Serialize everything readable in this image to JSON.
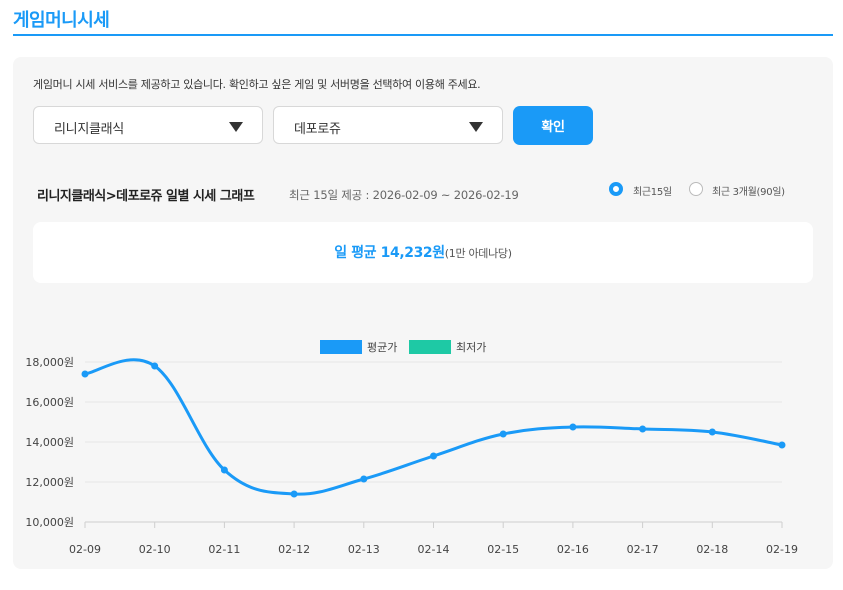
{
  "page": {
    "title": "게임머니시세"
  },
  "intro": "게임머니 시세 서비스를 제공하고 있습니다. 확인하고 싶은 게임 및 서버명을 선택하여 이용해 주세요.",
  "selectors": {
    "game": {
      "value": "리니지클래식"
    },
    "server": {
      "value": "데포로쥬"
    },
    "confirm_label": "확인"
  },
  "graph_header": {
    "title": "리니지클래식>데포로쥬 일별 시세 그래프",
    "subtitle": "최근 15일 제공 : 2026-02-09 ~ 2026-02-19"
  },
  "range_options": [
    {
      "label": "최근15일",
      "selected": true
    },
    {
      "label": "최근 3개월(90일)",
      "selected": false
    }
  ],
  "average": {
    "label": "일 평균 14,232원",
    "unit_note": "(1만 아데나당)"
  },
  "colors": {
    "accent": "#1a9af7",
    "min_series": "#1ec9a5"
  },
  "chart_data": {
    "type": "line",
    "categories": [
      "02-09",
      "02-10",
      "02-11",
      "02-12",
      "02-13",
      "02-14",
      "02-15",
      "02-16",
      "02-17",
      "02-18",
      "02-19"
    ],
    "series": [
      {
        "name": "평균가",
        "color": "#1a9af7",
        "values": [
          17400,
          17800,
          12600,
          11400,
          12150,
          13300,
          14400,
          14750,
          14650,
          14500,
          13850
        ]
      },
      {
        "name": "최저가",
        "color": "#1ec9a5",
        "values": []
      }
    ],
    "ylim": [
      10000,
      18000
    ],
    "yticks": [
      10000,
      12000,
      14000,
      16000,
      18000
    ],
    "ytick_labels": [
      "10,000원",
      "12,000원",
      "14,000원",
      "16,000원",
      "18,000원"
    ],
    "legend": "top-center",
    "grid": true
  }
}
